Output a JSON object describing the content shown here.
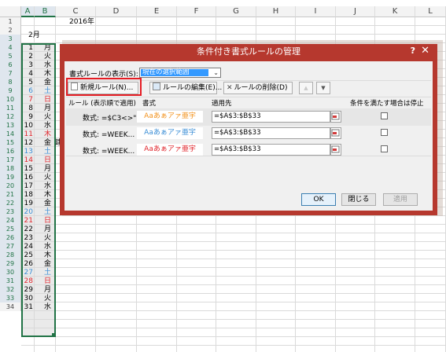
{
  "sheet": {
    "columns": [
      "A",
      "B",
      "C",
      "D",
      "E",
      "F",
      "G",
      "H",
      "I",
      "J",
      "K",
      "L"
    ],
    "rows": [
      "1",
      "2",
      "3",
      "4",
      "5",
      "6",
      "7",
      "8",
      "9",
      "10",
      "11",
      "12",
      "13",
      "14",
      "15",
      "16",
      "17",
      "18",
      "19",
      "20",
      "21",
      "22",
      "23",
      "24",
      "25",
      "26",
      "27",
      "28",
      "29",
      "30",
      "31",
      "32",
      "33",
      "34"
    ],
    "c1_text": "2016年",
    "a2_text": "2月",
    "c11_partial": "建",
    "day_nums": [
      "1",
      "2",
      "3",
      "4",
      "5",
      "6",
      "7",
      "8",
      "9",
      "10",
      "11",
      "12",
      "13",
      "14",
      "15",
      "16",
      "17",
      "18",
      "19",
      "20",
      "21",
      "22",
      "23",
      "24",
      "25",
      "26",
      "27",
      "28",
      "29",
      "30",
      "31"
    ],
    "weekdays": [
      "月",
      "火",
      "水",
      "木",
      "金",
      "土",
      "日",
      "月",
      "火",
      "水",
      "木",
      "金",
      "土",
      "日",
      "月",
      "火",
      "水",
      "木",
      "金",
      "土",
      "日",
      "月",
      "火",
      "水",
      "木",
      "金",
      "土",
      "日",
      "月",
      "火",
      "水"
    ],
    "colors": {
      "saturday": "#3b8ed6",
      "sunday": "#e0262d",
      "holiday": "#e0262d",
      "weekday": "#000000",
      "grid": "#dadada",
      "selection": "#217346"
    }
  },
  "dialog": {
    "title": "条件付き書式ルールの管理",
    "help_icon": "?",
    "close_icon": "✕",
    "show_rules_label": "書式ルールの表示(S):",
    "show_rules_value": "現在の選択範囲",
    "buttons": {
      "new_rule": "新規ルール(N)...",
      "edit_rule": "ルールの編集(E)...",
      "delete_rule": "ルールの削除(D)",
      "move_up": "▲",
      "move_down": "▼"
    },
    "headers": {
      "rule": "ルール (表示順で適用)",
      "format": "書式",
      "applies_to": "適用先",
      "stop_if_true": "条件を満たす場合は停止"
    },
    "rules": [
      {
        "formula": "数式: =$C3<>\"\"",
        "preview": "Aaあぁアァ亜宇",
        "preview_color": "#f2921d",
        "applies_to": "=$A$3:$B$33"
      },
      {
        "formula": "数式: =WEEK...",
        "preview": "Aaあぁアァ亜宇",
        "preview_color": "#3b8ed6",
        "applies_to": "=$A$3:$B$33"
      },
      {
        "formula": "数式: =WEEK...",
        "preview": "Aaあぁアァ亜宇",
        "preview_color": "#e0262d",
        "applies_to": "=$A$3:$B$33"
      }
    ],
    "footer": {
      "ok": "OK",
      "close": "閉じる",
      "apply": "適用"
    },
    "colors": {
      "titlebar": "#b6382e",
      "highlight": "#e51c23",
      "combo_selection": "#3399ff"
    }
  }
}
